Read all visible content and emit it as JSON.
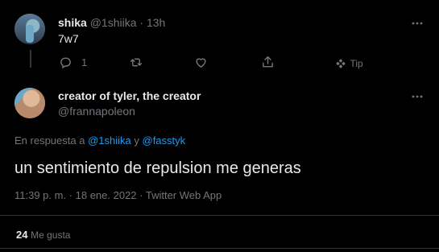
{
  "parent_tweet": {
    "display_name": "shika",
    "handle": "@1shiika",
    "separator": "·",
    "time": "13h",
    "text": "7w7",
    "reply_count": "1",
    "tip_label": "Tip"
  },
  "main_tweet": {
    "display_name": "creator of tyler, the creator",
    "handle": "@frannapoleon",
    "reply_prefix": "En respuesta a",
    "reply_user1": "@1shiika",
    "reply_conj": "y",
    "reply_user2": "@fasstyk",
    "text": "un sentimiento de repulsion me generas",
    "timestamp": "11:39 p. m. · 18 ene. 2022 · Twitter Web App",
    "likes_count": "24",
    "likes_label": "Me gusta"
  },
  "colors": {
    "background": "#000000",
    "text": "#e7e9ea",
    "muted": "#71767b",
    "link": "#1d9bf0",
    "divider": "#2f3336"
  }
}
